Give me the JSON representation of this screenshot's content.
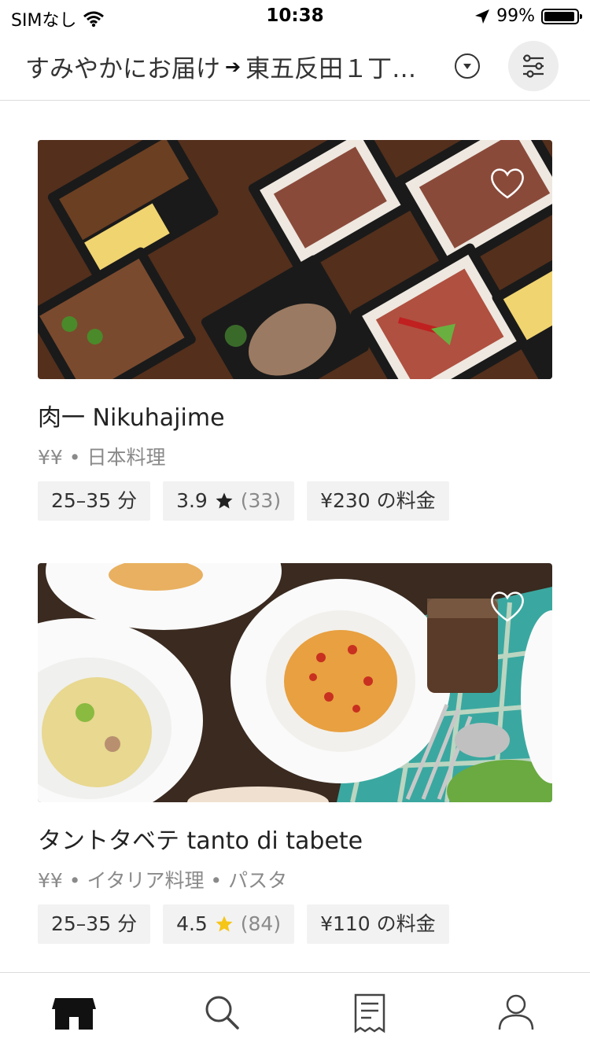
{
  "status_bar": {
    "carrier": "SIMなし",
    "time": "10:38",
    "battery": "99%"
  },
  "header": {
    "address_text": "すみやかにお届け",
    "arrow": "➔",
    "location": "東五反田１丁…"
  },
  "restaurants": [
    {
      "name": "肉一 Nikuhajime",
      "meta": "¥¥ • 日本料理",
      "time": "25–35 分",
      "rating": "3.9",
      "rating_count": "(33)",
      "star_color": "#222222",
      "fee": "¥230 の料金"
    },
    {
      "name": "タントタベテ tanto di tabete",
      "meta": "¥¥ • イタリア料理 • パスタ",
      "time": "25–35 分",
      "rating": "4.5",
      "rating_count": "(84)",
      "star_color": "#f5c518",
      "fee": "¥110 の料金"
    }
  ],
  "tabs": [
    {
      "icon": "store-icon",
      "active": true
    },
    {
      "icon": "search-icon",
      "active": false
    },
    {
      "icon": "receipt-icon",
      "active": false
    },
    {
      "icon": "account-icon",
      "active": false
    }
  ]
}
